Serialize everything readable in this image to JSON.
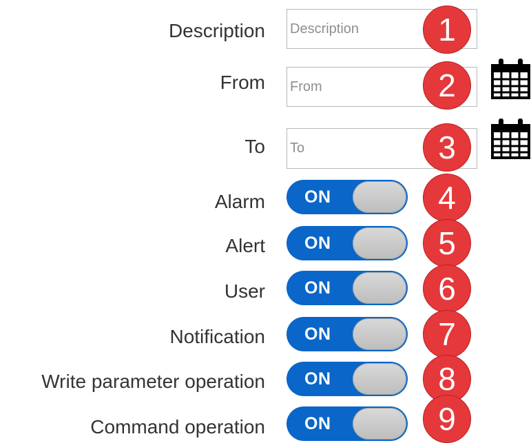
{
  "filters": {
    "description": {
      "label": "Description",
      "placeholder": "Description",
      "value": "",
      "badge": "1"
    },
    "from": {
      "label": "From",
      "placeholder": "From",
      "value": "",
      "badge": "2",
      "icon": "calendar-icon"
    },
    "to": {
      "label": "To",
      "placeholder": "To",
      "value": "",
      "badge": "3",
      "icon": "calendar-icon"
    }
  },
  "toggles": [
    {
      "label": "Alarm",
      "state": "ON",
      "badge": "4"
    },
    {
      "label": "Alert",
      "state": "ON",
      "badge": "5"
    },
    {
      "label": "User",
      "state": "ON",
      "badge": "6"
    },
    {
      "label": "Notification",
      "state": "ON",
      "badge": "7"
    },
    {
      "label": "Write parameter operation",
      "state": "ON",
      "badge": "8"
    },
    {
      "label": "Command operation",
      "state": "ON",
      "badge": "9"
    }
  ],
  "colors": {
    "toggle_on": "#0a66c8",
    "badge": "#e5383b",
    "label_text": "#333333"
  }
}
